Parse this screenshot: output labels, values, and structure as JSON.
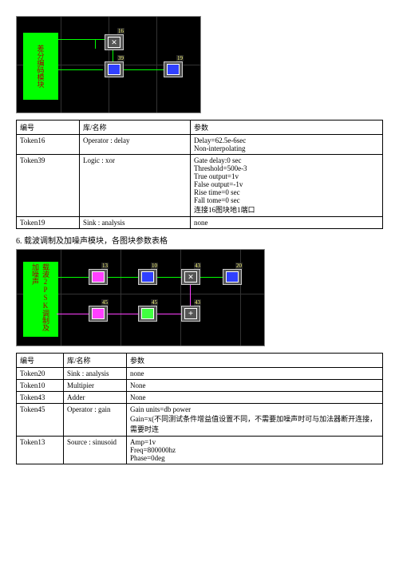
{
  "diagram1": {
    "label": "差分编码模块"
  },
  "table1": {
    "headers": [
      "编号",
      "库/名称",
      "参数"
    ],
    "rows": [
      {
        "id": "Token16",
        "name": "Operator : delay",
        "params": [
          "Delay=62.5e-6sec",
          "Non-interpolating"
        ]
      },
      {
        "id": "Token39",
        "name": "Logic : xor",
        "params": [
          "Gate delay:0 sec",
          "Threshold=500e-3",
          "True output=1v",
          "False output=-1v",
          "Rise time=0 sec",
          "Fall tome=0 sec",
          "连接16图块地1端口"
        ]
      },
      {
        "id": "Token19",
        "name": "Sink : analysis",
        "params": [
          "none"
        ]
      }
    ]
  },
  "caption1": "6. 载波调制及加噪声模块，各图块参数表格",
  "diagram2": {
    "label": "载波2PSK调制及加噪声"
  },
  "table2": {
    "headers": [
      "编号",
      "库/名称",
      "参数"
    ],
    "rows": [
      {
        "id": "Token20",
        "name": "Sink : analysis",
        "params": [
          "none"
        ]
      },
      {
        "id": "Token10",
        "name": "Multipier",
        "params": [
          "None"
        ]
      },
      {
        "id": "Token43",
        "name": "Adder",
        "params": [
          "None"
        ]
      },
      {
        "id": "Token45",
        "name": "Operator : gain",
        "params": [
          "Gain units=db power",
          "Gain=x(不同测试条件增益值设置不同，不需要加噪声时可与加法器断开连接，需要时连"
        ]
      },
      {
        "id": "Token13",
        "name": "Source : sinusoid",
        "params": [
          "Amp=1v",
          "Freq=800000hz",
          "Phase=0deg"
        ]
      }
    ]
  }
}
